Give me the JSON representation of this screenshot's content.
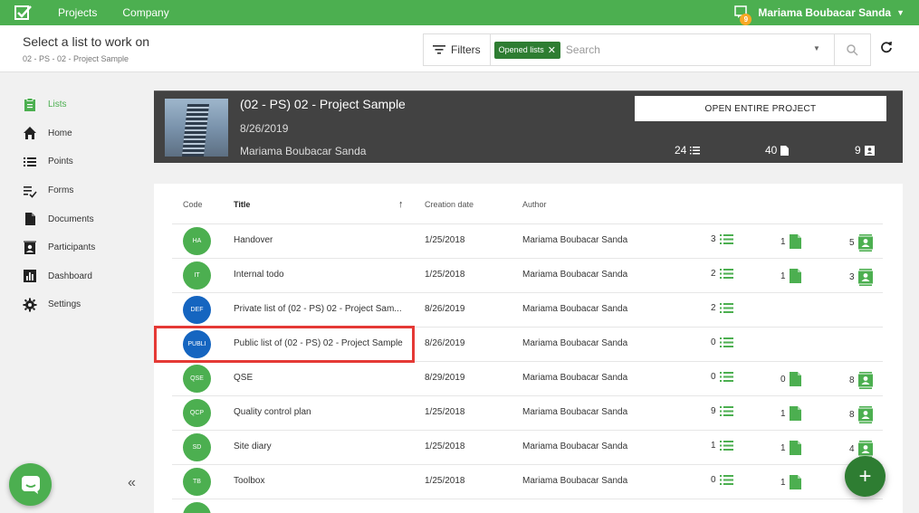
{
  "topbar": {
    "nav": [
      "Projects",
      "Company"
    ],
    "user_name": "Mariama Boubacar Sanda",
    "notification_count": "9"
  },
  "header": {
    "title": "Select a list to work on",
    "breadcrumb": "02 - PS - 02 - Project Sample",
    "filters_label": "Filters",
    "chip_label": "Opened lists",
    "search_placeholder": "Search"
  },
  "sidebar": {
    "items": [
      {
        "label": "Lists",
        "icon": "clipboard-icon",
        "active": true
      },
      {
        "label": "Home",
        "icon": "home-icon"
      },
      {
        "label": "Points",
        "icon": "list-icon"
      },
      {
        "label": "Forms",
        "icon": "checklist-icon"
      },
      {
        "label": "Documents",
        "icon": "document-icon"
      },
      {
        "label": "Participants",
        "icon": "contacts-icon"
      },
      {
        "label": "Dashboard",
        "icon": "chart-icon"
      },
      {
        "label": "Settings",
        "icon": "gear-icon"
      }
    ]
  },
  "project": {
    "title": "(02 - PS) 02 - Project Sample",
    "date": "8/26/2019",
    "author": "Mariama Boubacar Sanda",
    "open_label": "OPEN ENTIRE PROJECT",
    "stats": {
      "points": "24",
      "documents": "40",
      "participants": "9"
    }
  },
  "table": {
    "headers": {
      "code": "Code",
      "title": "Title",
      "date": "Creation date",
      "author": "Author"
    },
    "rows": [
      {
        "code": "HA",
        "color": "#4caf50",
        "title": "Handover",
        "date": "1/25/2018",
        "author": "Mariama Boubacar Sanda",
        "points": "3",
        "docs": "1",
        "participants": "5"
      },
      {
        "code": "IT",
        "color": "#4caf50",
        "title": "Internal todo",
        "date": "1/25/2018",
        "author": "Mariama Boubacar Sanda",
        "points": "2",
        "docs": "1",
        "participants": "3"
      },
      {
        "code": "DEF",
        "color": "#1565c0",
        "title": "Private list of (02 - PS) 02 - Project Sam...",
        "date": "8/26/2019",
        "author": "Mariama Boubacar Sanda",
        "points": "2",
        "docs": "",
        "participants": ""
      },
      {
        "code": "PUBLI",
        "color": "#1565c0",
        "title": "Public list of (02 - PS) 02 - Project Sample",
        "date": "8/26/2019",
        "author": "Mariama Boubacar Sanda",
        "points": "0",
        "docs": "",
        "participants": ""
      },
      {
        "code": "QSE",
        "color": "#4caf50",
        "title": "QSE",
        "date": "8/29/2019",
        "author": "Mariama Boubacar Sanda",
        "points": "0",
        "docs": "0",
        "participants": "8"
      },
      {
        "code": "QCP",
        "color": "#4caf50",
        "title": "Quality control plan",
        "date": "1/25/2018",
        "author": "Mariama Boubacar Sanda",
        "points": "9",
        "docs": "1",
        "participants": "8"
      },
      {
        "code": "SD",
        "color": "#4caf50",
        "title": "Site diary",
        "date": "1/25/2018",
        "author": "Mariama Boubacar Sanda",
        "points": "1",
        "docs": "1",
        "participants": "4"
      },
      {
        "code": "TB",
        "color": "#4caf50",
        "title": "Toolbox",
        "date": "1/25/2018",
        "author": "Mariama Boubacar Sanda",
        "points": "0",
        "docs": "1",
        "participants": ""
      },
      {
        "code": "",
        "color": "#4caf50",
        "title": "",
        "date": "",
        "author": "",
        "points": "",
        "docs": "",
        "participants": ""
      }
    ]
  },
  "colors": {
    "green": "#4caf50",
    "dark_green": "#2e7d32",
    "blue": "#1565c0",
    "highlight": "#e53935"
  }
}
